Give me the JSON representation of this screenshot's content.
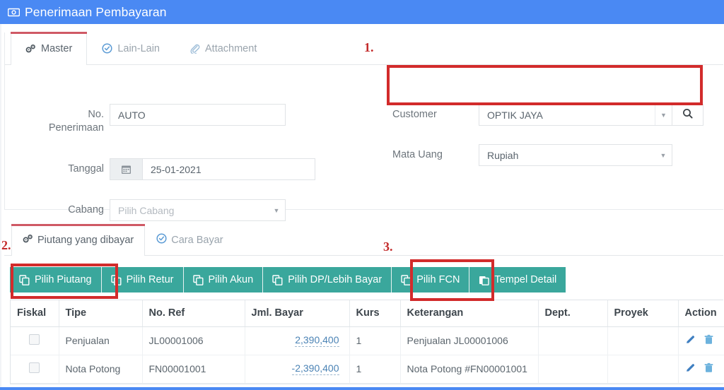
{
  "window": {
    "title": "Penerimaan Pembayaran",
    "title_icon": "banknote-icon",
    "header_color": "#4a89f3"
  },
  "master_tabs": [
    {
      "label": "Master",
      "icon": "gears-icon",
      "active": true
    },
    {
      "label": "Lain-Lain",
      "icon": "check-circle-icon",
      "active": false
    },
    {
      "label": "Attachment",
      "icon": "paperclip-icon",
      "active": false
    }
  ],
  "form": {
    "no_penerimaan": {
      "label_line1": "No.",
      "label_line2": "Penerimaan",
      "value": "AUTO"
    },
    "tanggal": {
      "label": "Tanggal",
      "value": "25-01-2021",
      "icon": "calendar-icon"
    },
    "cabang": {
      "label": "Cabang",
      "placeholder": "Pilih Cabang",
      "value": ""
    },
    "customer": {
      "label": "Customer",
      "value": "OPTIK JAYA",
      "search_icon": "search-icon"
    },
    "mata_uang": {
      "label": "Mata Uang",
      "value": "Rupiah"
    }
  },
  "detail_tabs": [
    {
      "label": "Piutang yang dibayar",
      "icon": "gears-icon",
      "active": true
    },
    {
      "label": "Cara Bayar",
      "icon": "check-circle-icon",
      "active": false
    }
  ],
  "toolbar": {
    "color": "#3aa79c",
    "buttons": [
      {
        "label": "Pilih Piutang",
        "icon": "copy-icon"
      },
      {
        "label": "Pilih Retur",
        "icon": "copy-icon"
      },
      {
        "label": "Pilih Akun",
        "icon": "copy-icon"
      },
      {
        "label": "Pilih DP/Lebih Bayar",
        "icon": "copy-icon"
      },
      {
        "label": "Pilih FCN",
        "icon": "copy-icon"
      },
      {
        "label": "Tempel Detail",
        "icon": "paste-icon"
      }
    ]
  },
  "table": {
    "columns": [
      "Fiskal",
      "Tipe",
      "No. Ref",
      "Jml. Bayar",
      "Kurs",
      "Keterangan",
      "Dept.",
      "Proyek",
      "Action"
    ],
    "rows": [
      {
        "fiskal": "",
        "tipe": "Penjualan",
        "no_ref": "JL00001006",
        "jml_bayar": "2,390,400",
        "kurs": "1",
        "keterangan": "Penjualan JL00001006",
        "dept": "",
        "proyek": "",
        "action_edit": "pencil-icon",
        "action_delete": "trash-icon"
      },
      {
        "fiskal": "",
        "tipe": "Nota Potong",
        "no_ref": "FN00001001",
        "jml_bayar": "-2,390,400",
        "kurs": "1",
        "keterangan": "Nota Potong #FN00001001",
        "dept": "",
        "proyek": "",
        "action_edit": "pencil-icon",
        "action_delete": "trash-icon"
      }
    ]
  },
  "annotations": {
    "color": "#d22b2b",
    "markers": [
      {
        "label": "1."
      },
      {
        "label": "2."
      },
      {
        "label": "3."
      }
    ]
  }
}
